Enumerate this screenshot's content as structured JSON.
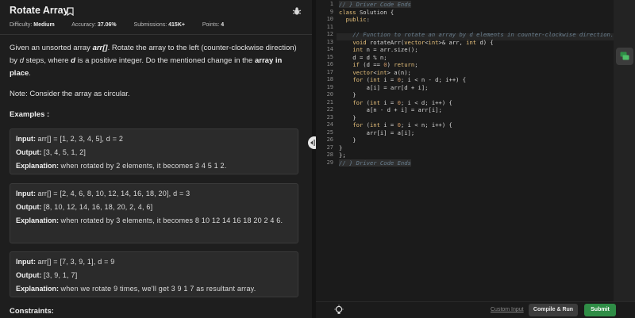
{
  "problem": {
    "title": "Rotate Array",
    "meta": {
      "difficulty_label": "Difficulty:",
      "difficulty_value": "Medium",
      "accuracy_label": "Accuracy:",
      "accuracy_value": "37.06%",
      "submissions_label": "Submissions:",
      "submissions_value": "415K+",
      "points_label": "Points:",
      "points_value": "4"
    },
    "description": {
      "a": "Given an unsorted array ",
      "b": "arr[]",
      "c": ". Rotate the array to the left (counter-clockwise direction) by ",
      "d": "d",
      "e": " steps, where ",
      "f": "d",
      "g": " is a positive integer. Do the mentioned change in the ",
      "h": "array in place",
      "i": "."
    },
    "note": "Note: Consider the array as circular.",
    "examples_heading": "Examples :",
    "input_label": "Input:",
    "output_label": "Output:",
    "explanation_label": "Explanation:",
    "examples": [
      {
        "input": "arr[] = [1, 2, 3, 4, 5], d = 2",
        "output": "[3, 4, 5, 1, 2]",
        "explanation": "when rotated by 2 elements, it becomes 3 4 5 1 2."
      },
      {
        "input": "arr[] = [2, 4, 6, 8, 10, 12, 14, 16, 18, 20], d = 3",
        "output": "[8, 10, 12, 14, 16, 18, 20, 2, 4, 6]",
        "explanation": "when rotated by 3 elements, it becomes 8 10 12 14 16 18 20 2 4 6."
      },
      {
        "input": "arr[] = [7, 3, 9, 1], d = 9",
        "output": "[3, 9, 1, 7]",
        "explanation": "when we rotate 9 times, we'll get 3 9 1 7 as resultant array."
      }
    ],
    "constraints_heading": "Constraints:"
  },
  "editor": {
    "lines": [
      {
        "n": "1",
        "text": "// } Driver Code Ends"
      },
      {
        "n": "9",
        "text": "class Solution {"
      },
      {
        "n": "10",
        "text": "  public:"
      },
      {
        "n": "11",
        "text": ""
      },
      {
        "n": "12",
        "text": "    // Function to rotate an array by d elements in counter-clockwise direction."
      },
      {
        "n": "13",
        "text": "    void rotateArr(vector<int>& arr, int d) {"
      },
      {
        "n": "14",
        "text": "    int n = arr.size();"
      },
      {
        "n": "15",
        "text": "    d = d % n;"
      },
      {
        "n": "16",
        "text": "    if (d == 0) return;"
      },
      {
        "n": "17",
        "text": "    vector<int> a(n);"
      },
      {
        "n": "18",
        "text": "    for (int i = 0; i < n - d; i++) {"
      },
      {
        "n": "19",
        "text": "        a[i] = arr[d + i];"
      },
      {
        "n": "20",
        "text": "    }"
      },
      {
        "n": "21",
        "text": "    for (int i = 0; i < d; i++) {"
      },
      {
        "n": "22",
        "text": "        a[n - d + i] = arr[i];"
      },
      {
        "n": "23",
        "text": "    }"
      },
      {
        "n": "24",
        "text": "    for (int i = 0; i < n; i++) {"
      },
      {
        "n": "25",
        "text": "        arr[i] = a[i];"
      },
      {
        "n": "26",
        "text": "    }"
      },
      {
        "n": "27",
        "text": "}"
      },
      {
        "n": "28",
        "text": "};"
      },
      {
        "n": "29",
        "text": "// } Driver Code Ends"
      }
    ]
  },
  "footer": {
    "custom_input": "Custom Input",
    "compile_run": "Compile & Run",
    "submit": "Submit"
  },
  "colors": {
    "submit_green": "#2f8d46",
    "code_keyword": "#e6c07b",
    "code_comment": "#6a7f8f",
    "chat_green": "#2f8d46"
  },
  "icons": {
    "bookmark": "bookmark-icon",
    "bug": "bug-icon",
    "splitter": "drag-handle-icon",
    "chat": "chat-icon",
    "bulb": "lightbulb-icon"
  }
}
